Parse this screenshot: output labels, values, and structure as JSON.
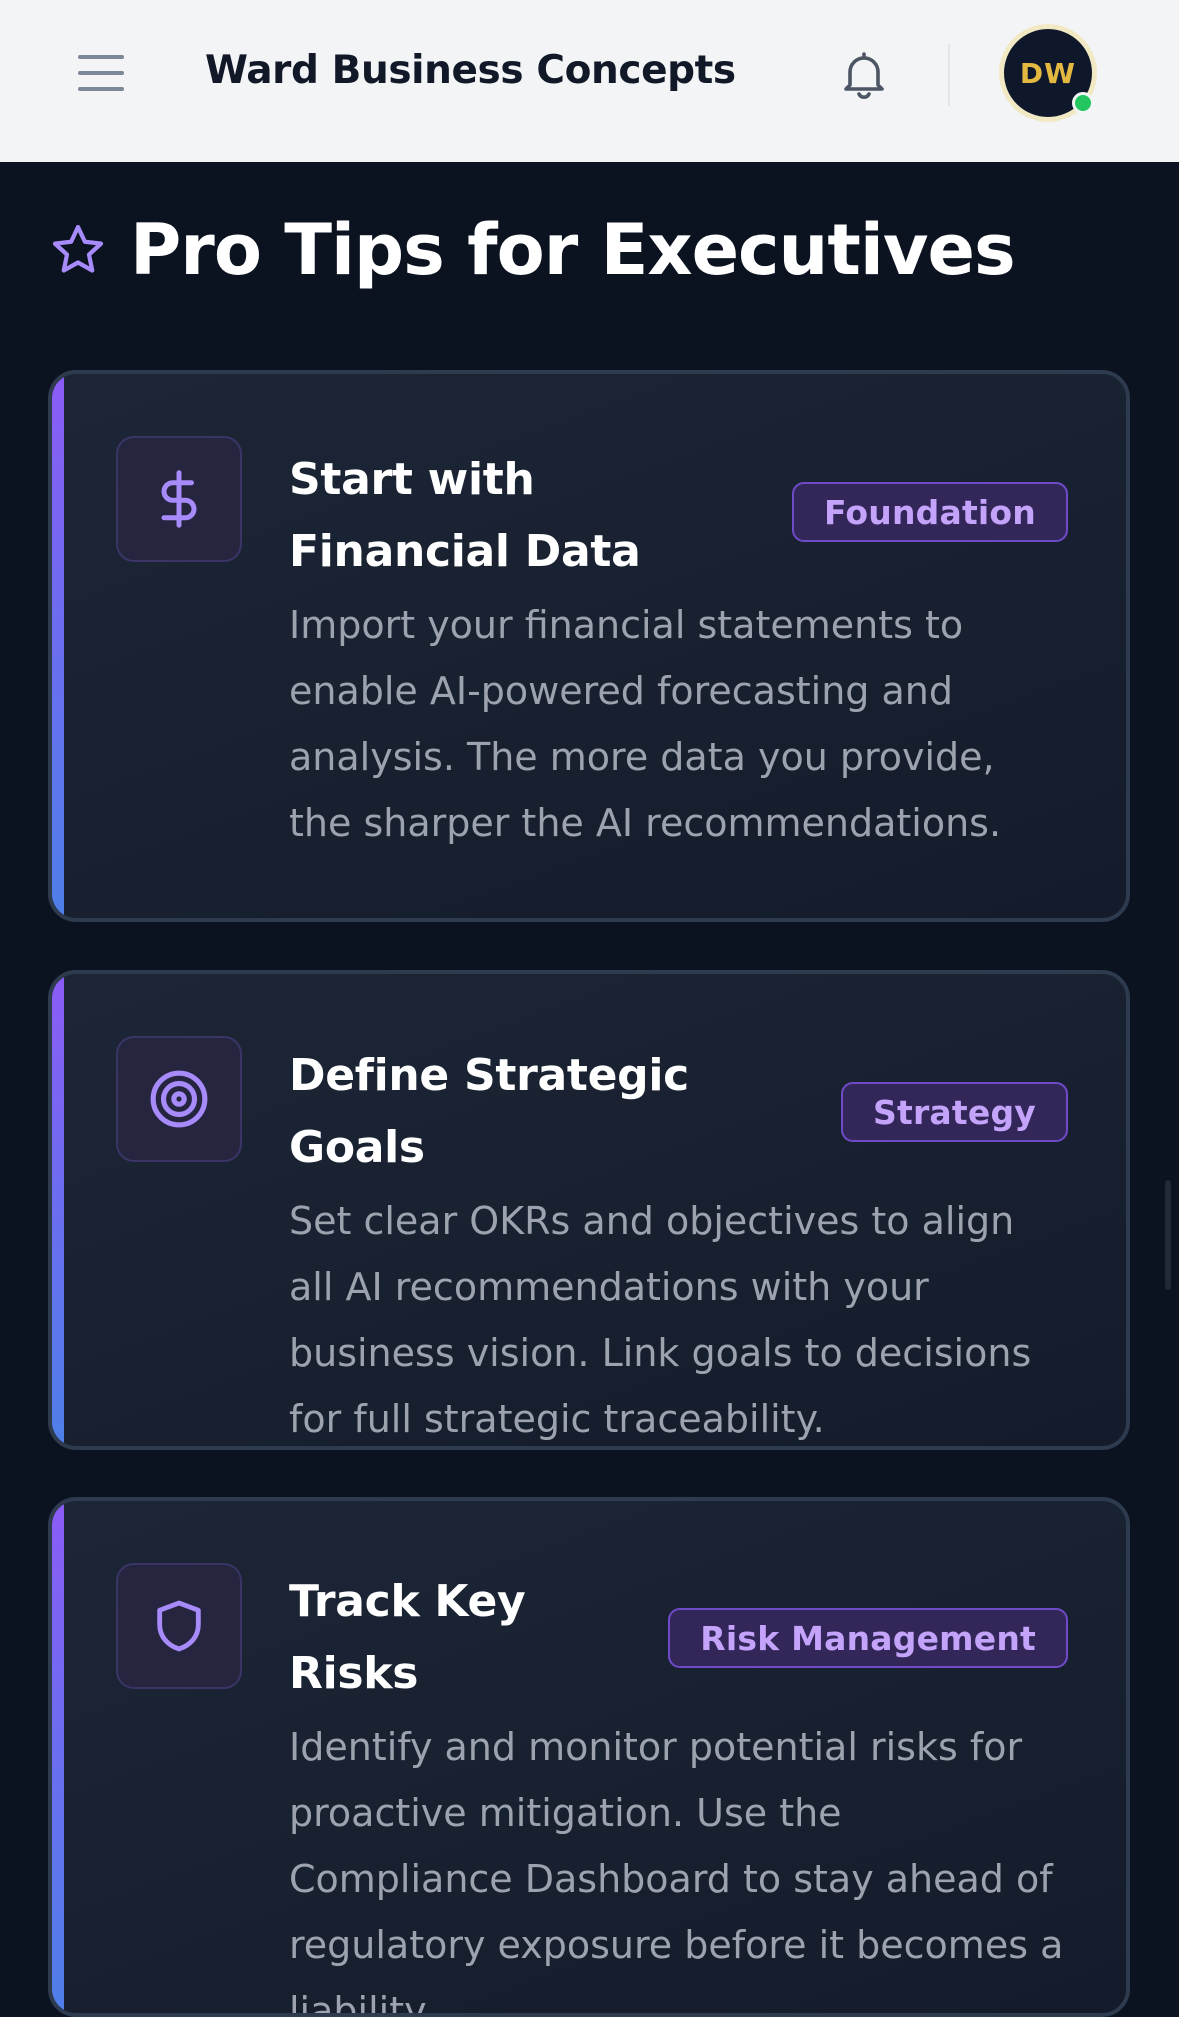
{
  "header": {
    "app_title": "Ward Business Concepts",
    "avatar_initials": "DW",
    "online_status_color": "#22c55e"
  },
  "section": {
    "title": "Pro Tips for Executives",
    "icon": "star-icon"
  },
  "tips": [
    {
      "icon": "dollar-icon",
      "title": "Start with Financial Data",
      "badge": "Foundation",
      "description": "Import your financial statements to enable AI-powered forecasting and analysis. The more data you provide, the sharper the AI recommendations."
    },
    {
      "icon": "target-icon",
      "title": "Define Strategic Goals",
      "badge": "Strategy",
      "description": "Set clear OKRs and objectives to align all AI recommendations with your business vision. Link goals to decisions for full strategic traceability."
    },
    {
      "icon": "shield-icon",
      "title": "Track Key Risks",
      "badge": "Risk Management",
      "description": "Identify and monitor potential risks for proactive mitigation. Use the Compliance Dashboard to stay ahead of regulatory exposure before it becomes a liability."
    }
  ],
  "colors": {
    "accent_purple": "#8b5cf6",
    "accent_blue": "#4f7fe8",
    "badge_text": "#c4a3fb",
    "avatar_gold": "#e3b941",
    "background": "#0b1220"
  }
}
